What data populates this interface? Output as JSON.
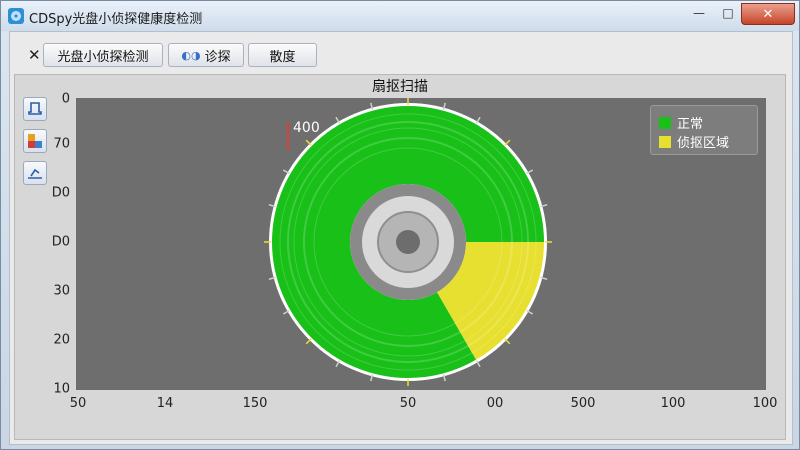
{
  "window": {
    "title": "CDSpy光盘小侦探健康度检测",
    "minimize_symbol": "—",
    "maximize_symbol": "□",
    "close_symbol": "✕"
  },
  "tabs": {
    "close_symbol": "✕",
    "items": [
      {
        "label": "光盘小侦探检测"
      },
      {
        "label": "诊探",
        "icon": "scan-icon"
      },
      {
        "label": "散度"
      }
    ]
  },
  "toolbar": {
    "icons": [
      "probe-icon",
      "color-map-icon",
      "trend-icon"
    ]
  },
  "chart_data": {
    "type": "disc-scan",
    "title": "扇抠扫描",
    "y_tick_labels": [
      "0",
      "70",
      "D0",
      "D0",
      "30",
      "20",
      "10"
    ],
    "x_tick_labels": [
      "50",
      "14",
      "150",
      "50",
      "00",
      "500",
      "100",
      "100"
    ],
    "marker_value": "400",
    "legend": [
      {
        "label": "正常",
        "color": "#18c018"
      },
      {
        "label": "侦抠区域",
        "color": "#e8e030"
      }
    ],
    "sectors": [
      {
        "status": "正常",
        "start_deg": 180,
        "end_deg": 360
      },
      {
        "status": "正常",
        "start_deg": 90,
        "end_deg": 180
      },
      {
        "status": "侦抠区域",
        "start_deg": 0,
        "end_deg": 60
      },
      {
        "status": "正常",
        "start_deg": 60,
        "end_deg": 90
      }
    ],
    "grid": false,
    "legend_position": "top-right",
    "background_color": "#6e6e6e"
  }
}
